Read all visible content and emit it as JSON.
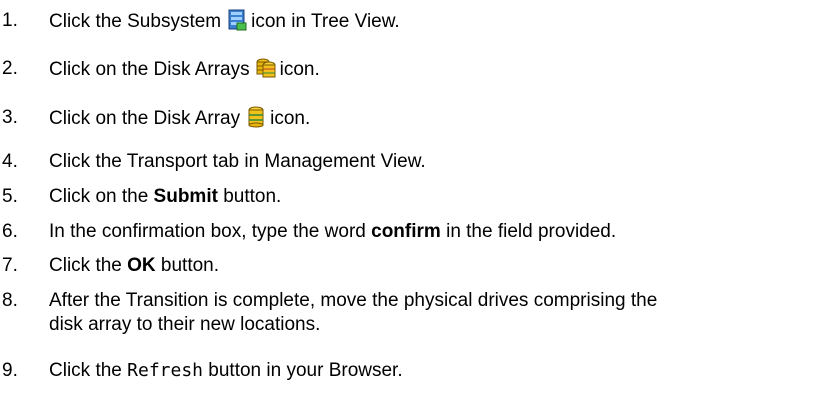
{
  "steps": [
    {
      "num": "1.",
      "parts": [
        "Click the Subsystem",
        "icon in Tree View."
      ]
    },
    {
      "num": "2.",
      "parts": [
        "Click on the Disk Arrays",
        "icon."
      ]
    },
    {
      "num": "3.",
      "parts": [
        "Click on the Disk Array",
        "icon."
      ]
    },
    {
      "num": "4.",
      "parts": [
        "Click the Transport tab in Management View."
      ]
    },
    {
      "num": "5.",
      "parts": [
        "Click on the ",
        "Submit",
        " button."
      ]
    },
    {
      "num": "6.",
      "parts": [
        "In the confirmation box, type the word ",
        "confirm",
        " in the field provided."
      ]
    },
    {
      "num": "7.",
      "parts": [
        "Click the ",
        "OK",
        " button."
      ]
    },
    {
      "num": "8.",
      "parts": [
        "After the Transition is complete, move the physical drives comprising the",
        "disk array to their new locations."
      ]
    },
    {
      "num": "9.",
      "parts": [
        "Click the ",
        "Refresh",
        " button in your Browser."
      ]
    }
  ],
  "icons": {
    "subsystem": "subsystem-icon",
    "disk_arrays": "disk-arrays-icon",
    "disk_array": "disk-array-icon"
  }
}
